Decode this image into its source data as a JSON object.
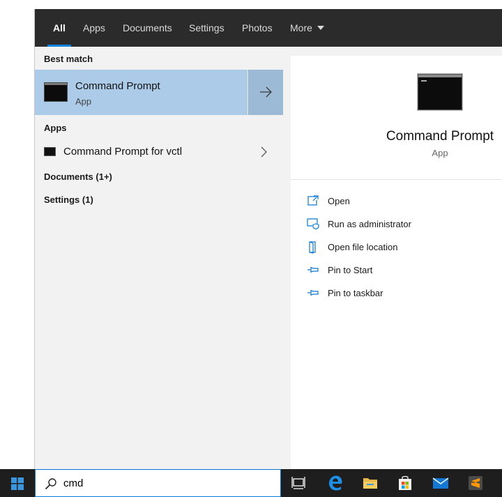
{
  "tabs": {
    "all": "All",
    "apps": "Apps",
    "documents": "Documents",
    "settings": "Settings",
    "photos": "Photos",
    "more": "More"
  },
  "results": {
    "best_match_heading": "Best match",
    "best_match_title": "Command Prompt",
    "best_match_subtitle": "App",
    "apps_heading": "Apps",
    "apps_items": [
      {
        "label": "Command Prompt for vctl"
      }
    ],
    "documents_heading": "Documents (1+)",
    "settings_heading": "Settings (1)"
  },
  "details": {
    "title": "Command Prompt",
    "subtitle": "App",
    "actions": [
      {
        "label": "Open",
        "icon": "open-icon"
      },
      {
        "label": "Run as administrator",
        "icon": "shield-icon"
      },
      {
        "label": "Open file location",
        "icon": "folder-icon"
      },
      {
        "label": "Pin to Start",
        "icon": "pin-icon"
      },
      {
        "label": "Pin to taskbar",
        "icon": "pin-icon"
      }
    ]
  },
  "search": {
    "query": "cmd"
  },
  "colors": {
    "accent": "#0a84e0",
    "selected": "#abcbe8",
    "topbar": "#2b2b2b",
    "taskbar": "#1e1e1e"
  }
}
